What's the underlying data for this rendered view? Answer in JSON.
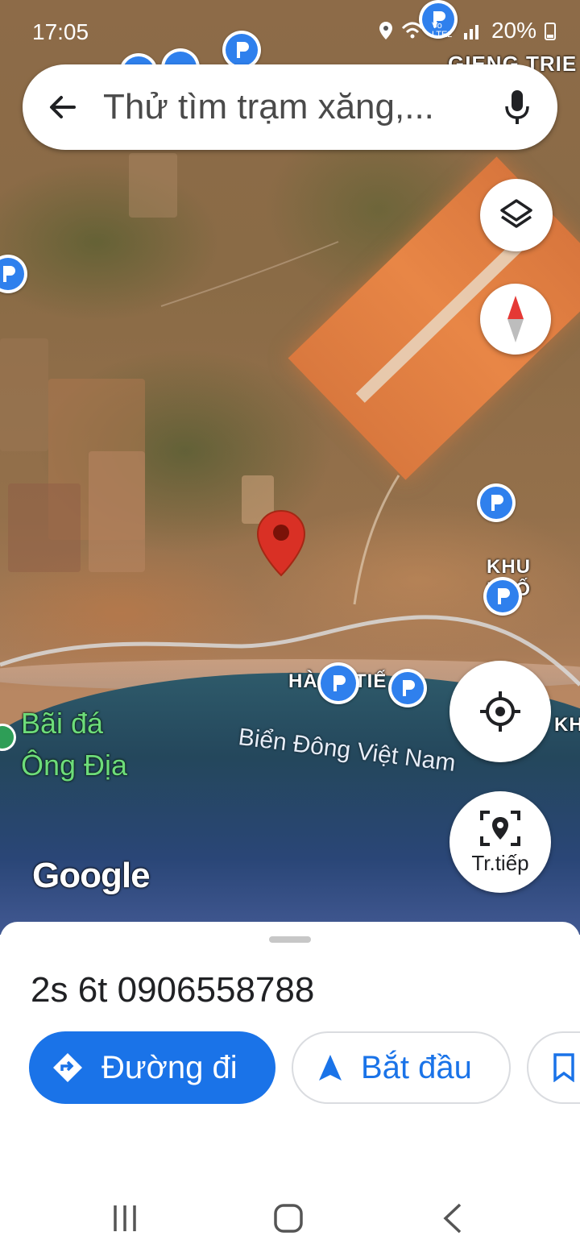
{
  "status_bar": {
    "time": "17:05",
    "battery": "20%",
    "network_label": "Vo LTE2"
  },
  "search": {
    "placeholder": "Thử tìm trạm xăng,..."
  },
  "map": {
    "labels": {
      "top_right": "GIENG TRIE",
      "khu_pho": "KHU PHỐ",
      "ham_tien_left": "HÀ",
      "ham_tien_right": "TIẾ",
      "right_edge": "KH",
      "green_place_line1": "Bãi đá",
      "green_place_line2": "Ông Địa",
      "sea": "Biển Đông Việt Nam"
    },
    "logo": "Google"
  },
  "controls": {
    "layers_icon": "layers-icon",
    "compass_icon": "compass-icon",
    "my_location_icon": "crosshair-icon",
    "live_view_label": "Tr.tiếp"
  },
  "place": {
    "title": "2s 6t 0906558788",
    "directions_label": "Đường đi",
    "start_label": "Bắt đầu"
  },
  "colors": {
    "accent": "#1a73e8",
    "pin": "#d93025",
    "poi_blue": "#2f80ed",
    "poi_green": "#2e9e57"
  }
}
